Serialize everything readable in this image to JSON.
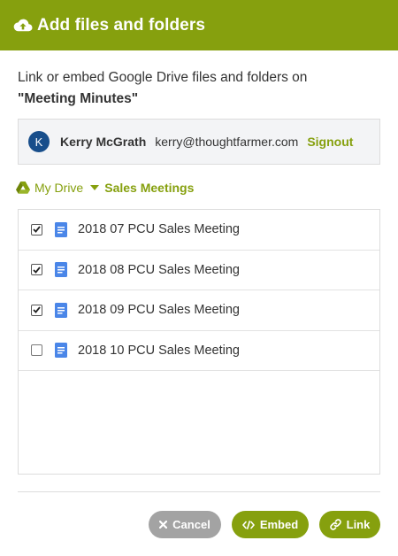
{
  "dialog": {
    "title": "Add files and folders",
    "intro": "Link or embed Google Drive files and folders on",
    "target": "\"Meeting Minutes\""
  },
  "account": {
    "avatar_initial": "K",
    "name": "Kerry McGrath",
    "email": "kerry@thoughtfarmer.com",
    "signout_label": "Signout"
  },
  "breadcrumb": {
    "root": "My Drive",
    "current": "Sales Meetings"
  },
  "files": [
    {
      "name": "2018 07 PCU Sales Meeting",
      "checked": true
    },
    {
      "name": "2018 08 PCU Sales Meeting",
      "checked": true
    },
    {
      "name": "2018 09 PCU Sales Meeting",
      "checked": true
    },
    {
      "name": "2018 10 PCU Sales Meeting",
      "checked": false
    }
  ],
  "actions": {
    "cancel_label": "Cancel",
    "embed_label": "Embed",
    "link_label": "Link"
  },
  "icons": {
    "header": "cloud-upload-icon",
    "drive": "google-drive-icon",
    "file": "google-doc-icon",
    "cancel": "close-icon",
    "embed": "code-icon",
    "link": "link-icon"
  },
  "colors": {
    "accent": "#86a00e",
    "cancel": "#a3a3a3",
    "avatar": "#184e8b",
    "doc": "#4a86e8"
  }
}
